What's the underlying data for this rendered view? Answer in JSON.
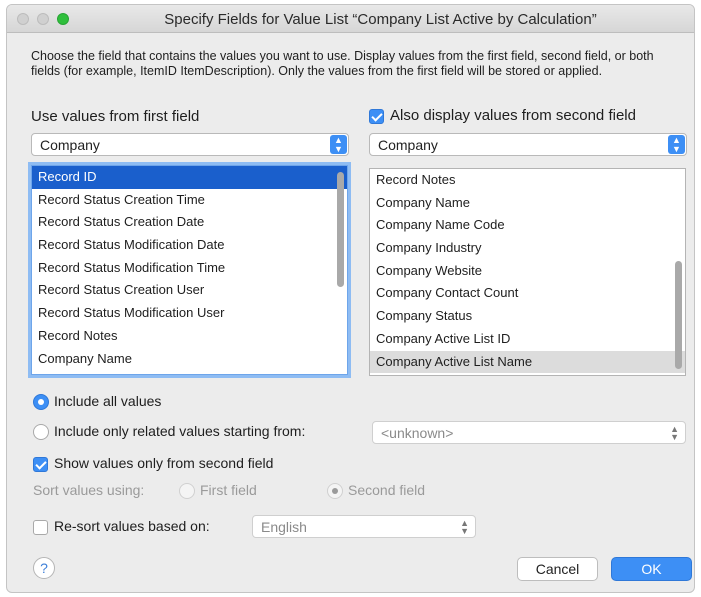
{
  "window": {
    "title": "Specify Fields for Value List “Company List Active by Calculation”",
    "description": "Choose the field that contains the values you want to use.  Display values from the first field, second field, or both fields (for example, ItemID ItemDescription). Only the values from the first field will be stored or applied."
  },
  "first_field": {
    "header": "Use values from first field",
    "table_value": "Company",
    "fields": [
      {
        "label": "Record ID",
        "selected": true
      },
      {
        "label": "Record Status Creation Time"
      },
      {
        "label": "Record Status Creation Date"
      },
      {
        "label": "Record Status Modification Date"
      },
      {
        "label": "Record Status Modification Time"
      },
      {
        "label": "Record Status Creation User"
      },
      {
        "label": "Record Status Modification User"
      },
      {
        "label": "Record Notes"
      },
      {
        "label": "Company Name"
      }
    ]
  },
  "second_field": {
    "checkbox_label": "Also display values from second field",
    "checked": true,
    "table_value": "Company",
    "fields": [
      {
        "label": "Record Notes"
      },
      {
        "label": "Company Name"
      },
      {
        "label": "Company Name Code"
      },
      {
        "label": "Company Industry"
      },
      {
        "label": "Company Website"
      },
      {
        "label": "Company Contact Count"
      },
      {
        "label": "Company Status"
      },
      {
        "label": "Company Active List ID"
      },
      {
        "label": "Company Active List Name",
        "selected": true
      }
    ]
  },
  "options": {
    "include_all_label": "Include all values",
    "include_related_label": "Include only related values starting from:",
    "related_value": "<unknown>",
    "show_second_label": "Show values only from second field",
    "show_second_checked": true,
    "sort_label": "Sort values using:",
    "sort_first_label": "First field",
    "sort_second_label": "Second field",
    "resort_label": "Re-sort values based on:",
    "resort_checked": false,
    "resort_language": "English"
  },
  "buttons": {
    "help": "?",
    "cancel": "Cancel",
    "ok": "OK"
  },
  "colors": {
    "accent": "#3d8ff5",
    "selection": "#1a5fcc"
  }
}
